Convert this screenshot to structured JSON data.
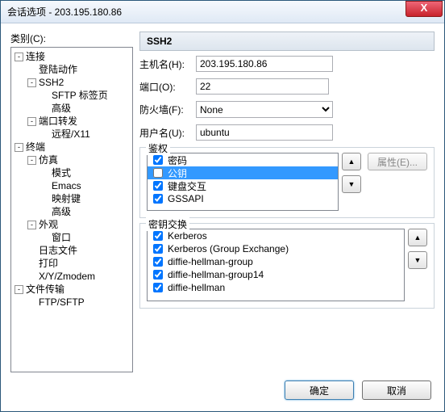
{
  "window": {
    "title": "会话选项 - 203.195.180.86"
  },
  "left": {
    "category_label": "类别(C):",
    "tree": [
      {
        "depth": 0,
        "exp": "-",
        "label": "连接"
      },
      {
        "depth": 1,
        "exp": "",
        "label": "登陆动作"
      },
      {
        "depth": 1,
        "exp": "-",
        "label": "SSH2"
      },
      {
        "depth": 2,
        "exp": "",
        "label": "SFTP 标签页"
      },
      {
        "depth": 2,
        "exp": "",
        "label": "高级"
      },
      {
        "depth": 1,
        "exp": "-",
        "label": "端口转发"
      },
      {
        "depth": 2,
        "exp": "",
        "label": "远程/X11"
      },
      {
        "depth": 0,
        "exp": "-",
        "label": "终端"
      },
      {
        "depth": 1,
        "exp": "-",
        "label": "仿真"
      },
      {
        "depth": 2,
        "exp": "",
        "label": "模式"
      },
      {
        "depth": 2,
        "exp": "",
        "label": "Emacs"
      },
      {
        "depth": 2,
        "exp": "",
        "label": "映射键"
      },
      {
        "depth": 2,
        "exp": "",
        "label": "高级"
      },
      {
        "depth": 1,
        "exp": "-",
        "label": "外观"
      },
      {
        "depth": 2,
        "exp": "",
        "label": "窗口"
      },
      {
        "depth": 1,
        "exp": "",
        "label": "日志文件"
      },
      {
        "depth": 1,
        "exp": "",
        "label": "打印"
      },
      {
        "depth": 1,
        "exp": "",
        "label": "X/Y/Zmodem"
      },
      {
        "depth": 0,
        "exp": "-",
        "label": "文件传输"
      },
      {
        "depth": 1,
        "exp": "",
        "label": "FTP/SFTP"
      }
    ]
  },
  "right": {
    "header": "SSH2",
    "host_label": "主机名(H):",
    "host_value": "203.195.180.86",
    "port_label": "端口(O):",
    "port_value": "22",
    "fw_label": "防火墙(F):",
    "fw_value": "None",
    "user_label": "用户名(U):",
    "user_value": "ubuntu",
    "auth": {
      "title": "鉴权",
      "items": [
        {
          "checked": true,
          "label": "密码",
          "selected": false
        },
        {
          "checked": false,
          "label": "公钥",
          "selected": true
        },
        {
          "checked": true,
          "label": "键盘交互",
          "selected": false
        },
        {
          "checked": true,
          "label": "GSSAPI",
          "selected": false
        }
      ],
      "prop_btn": "属性(E)..."
    },
    "kex": {
      "title": "密钥交换",
      "items": [
        {
          "checked": true,
          "label": "Kerberos"
        },
        {
          "checked": true,
          "label": "Kerberos (Group Exchange)"
        },
        {
          "checked": true,
          "label": "diffie-hellman-group"
        },
        {
          "checked": true,
          "label": "diffie-hellman-group14"
        },
        {
          "checked": true,
          "label": "diffie-hellman"
        }
      ]
    }
  },
  "footer": {
    "ok": "确定",
    "cancel": "取消"
  },
  "glyph": {
    "up": "▲",
    "down": "▼",
    "close": "X"
  }
}
